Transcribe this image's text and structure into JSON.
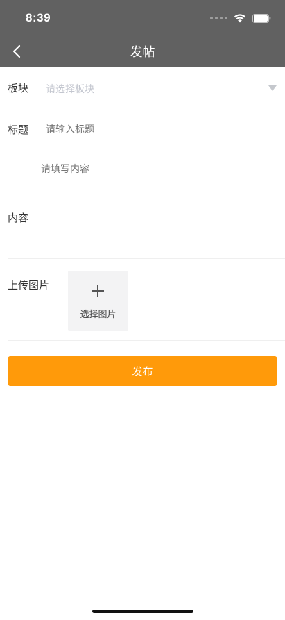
{
  "status_bar": {
    "time": "8:39"
  },
  "nav": {
    "title": "发帖"
  },
  "form": {
    "board": {
      "label": "板块",
      "placeholder": "请选择板块"
    },
    "title": {
      "label": "标题",
      "placeholder": "请输入标题"
    },
    "content": {
      "label": "内容",
      "placeholder": "请填写内容"
    },
    "image": {
      "label": "上传图片",
      "picker_label": "选择图片"
    }
  },
  "actions": {
    "publish_label": "发布"
  },
  "colors": {
    "header_bg": "#616161",
    "accent": "#ff9a0a",
    "placeholder": "#c3c6cf"
  }
}
